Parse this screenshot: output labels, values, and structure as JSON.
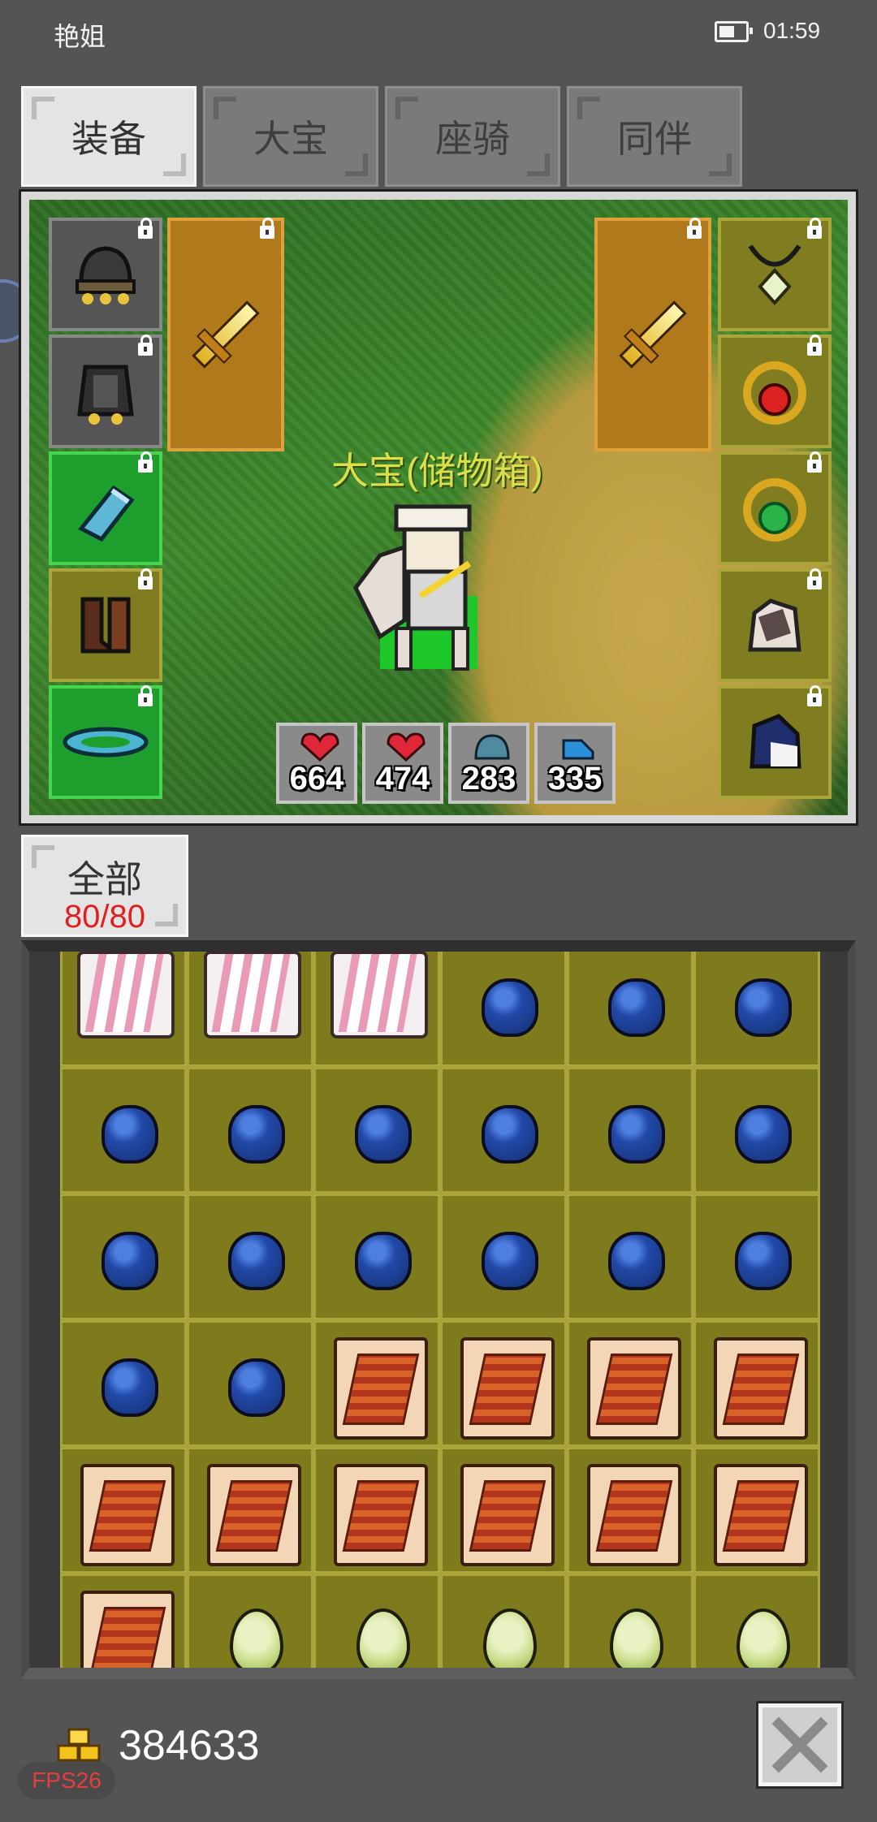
{
  "status_bar": {
    "name": "艳姐",
    "time": "01:59"
  },
  "tabs": [
    {
      "label": "装备",
      "active": true
    },
    {
      "label": "大宝",
      "active": false
    },
    {
      "label": "座骑",
      "active": false
    },
    {
      "label": "同伴",
      "active": false
    }
  ],
  "character": {
    "name": "大宝(储物箱)"
  },
  "stats": [
    {
      "icon": "heart-gift-icon",
      "value": "664"
    },
    {
      "icon": "heart-gift-icon",
      "value": "474"
    },
    {
      "icon": "helmet-icon",
      "value": "283"
    },
    {
      "icon": "boot-icon",
      "value": "335"
    }
  ],
  "equipment_left": [
    {
      "icon": "helmet-icon",
      "rarity": "grey"
    },
    {
      "icon": "armor-icon",
      "rarity": "grey"
    },
    {
      "icon": "gauntlet-icon",
      "rarity": "green"
    },
    {
      "icon": "boots-icon",
      "rarity": "olive"
    },
    {
      "icon": "belt-icon",
      "rarity": "green"
    }
  ],
  "equipment_right": [
    {
      "icon": "necklace-icon",
      "rarity": "olive"
    },
    {
      "icon": "ruby-ring-icon",
      "rarity": "olive"
    },
    {
      "icon": "emerald-ring-icon",
      "rarity": "olive"
    },
    {
      "icon": "mount-icon",
      "rarity": "olive"
    },
    {
      "icon": "companion-icon",
      "rarity": "olive"
    }
  ],
  "weapons": [
    {
      "icon": "sword-icon"
    },
    {
      "icon": "sword-icon"
    }
  ],
  "filter": {
    "label": "全部",
    "count": "80/80"
  },
  "inventory": [
    "feather",
    "feather",
    "feather",
    "gem",
    "gem",
    "gem",
    "gem",
    "gem",
    "gem",
    "gem",
    "gem",
    "gem",
    "gem",
    "gem",
    "gem",
    "gem",
    "gem",
    "gem",
    "gem",
    "gem",
    "scroll",
    "scroll",
    "scroll",
    "scroll",
    "scroll",
    "scroll",
    "scroll",
    "scroll",
    "scroll",
    "scroll",
    "scroll",
    "egg",
    "egg",
    "egg",
    "egg",
    "egg"
  ],
  "gold": {
    "amount": "384633"
  },
  "fps": "FPS26",
  "colors": {
    "background": "#545454",
    "slot_olive": "#7e7b1c",
    "slot_green": "#1e9e2c",
    "count_red": "#e21e1e"
  }
}
